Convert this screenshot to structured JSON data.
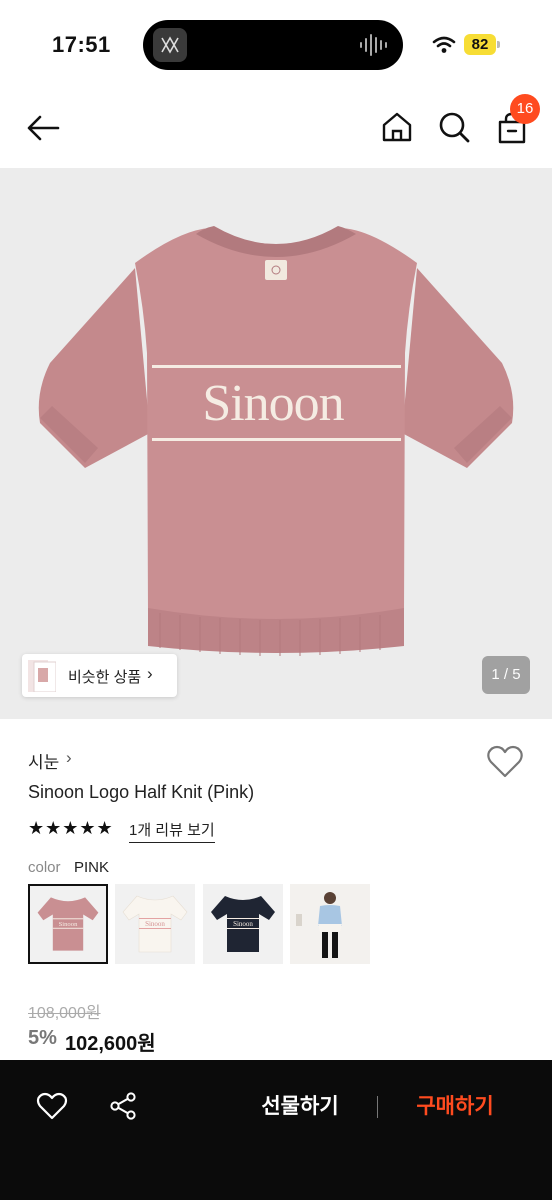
{
  "status_bar": {
    "time": "17:51",
    "battery": "82"
  },
  "header": {
    "cart_count": "16"
  },
  "gallery": {
    "shirt_logo": "Sinoon",
    "similar_label": "비슷한 상품",
    "similar_chevron": "›",
    "counter": "1 / 5"
  },
  "product": {
    "brand": "시눈",
    "brand_chevron": "›",
    "name": "Sinoon Logo Half Knit (Pink)",
    "stars": "★★★★★",
    "review_link": "1개 리뷰 보기",
    "color_label": "color",
    "color_value": "PINK",
    "original_price": "108,000원",
    "discount": "5%",
    "sale_price": "102,600원"
  },
  "swatches": [
    {
      "color": "#c98f92",
      "logo": "Sinoon"
    },
    {
      "color": "#f5f1ea",
      "logo": "Sinoon"
    },
    {
      "color": "#1f2533",
      "logo": "Sinoon"
    },
    {
      "color": "#a8c6e3"
    }
  ],
  "bottom_bar": {
    "gift_label": "선물하기",
    "buy_label": "구매하기"
  },
  "colors": {
    "accent": "#ff4b1f",
    "shirt": "#c98f92",
    "bar": "#0b0b0b"
  }
}
